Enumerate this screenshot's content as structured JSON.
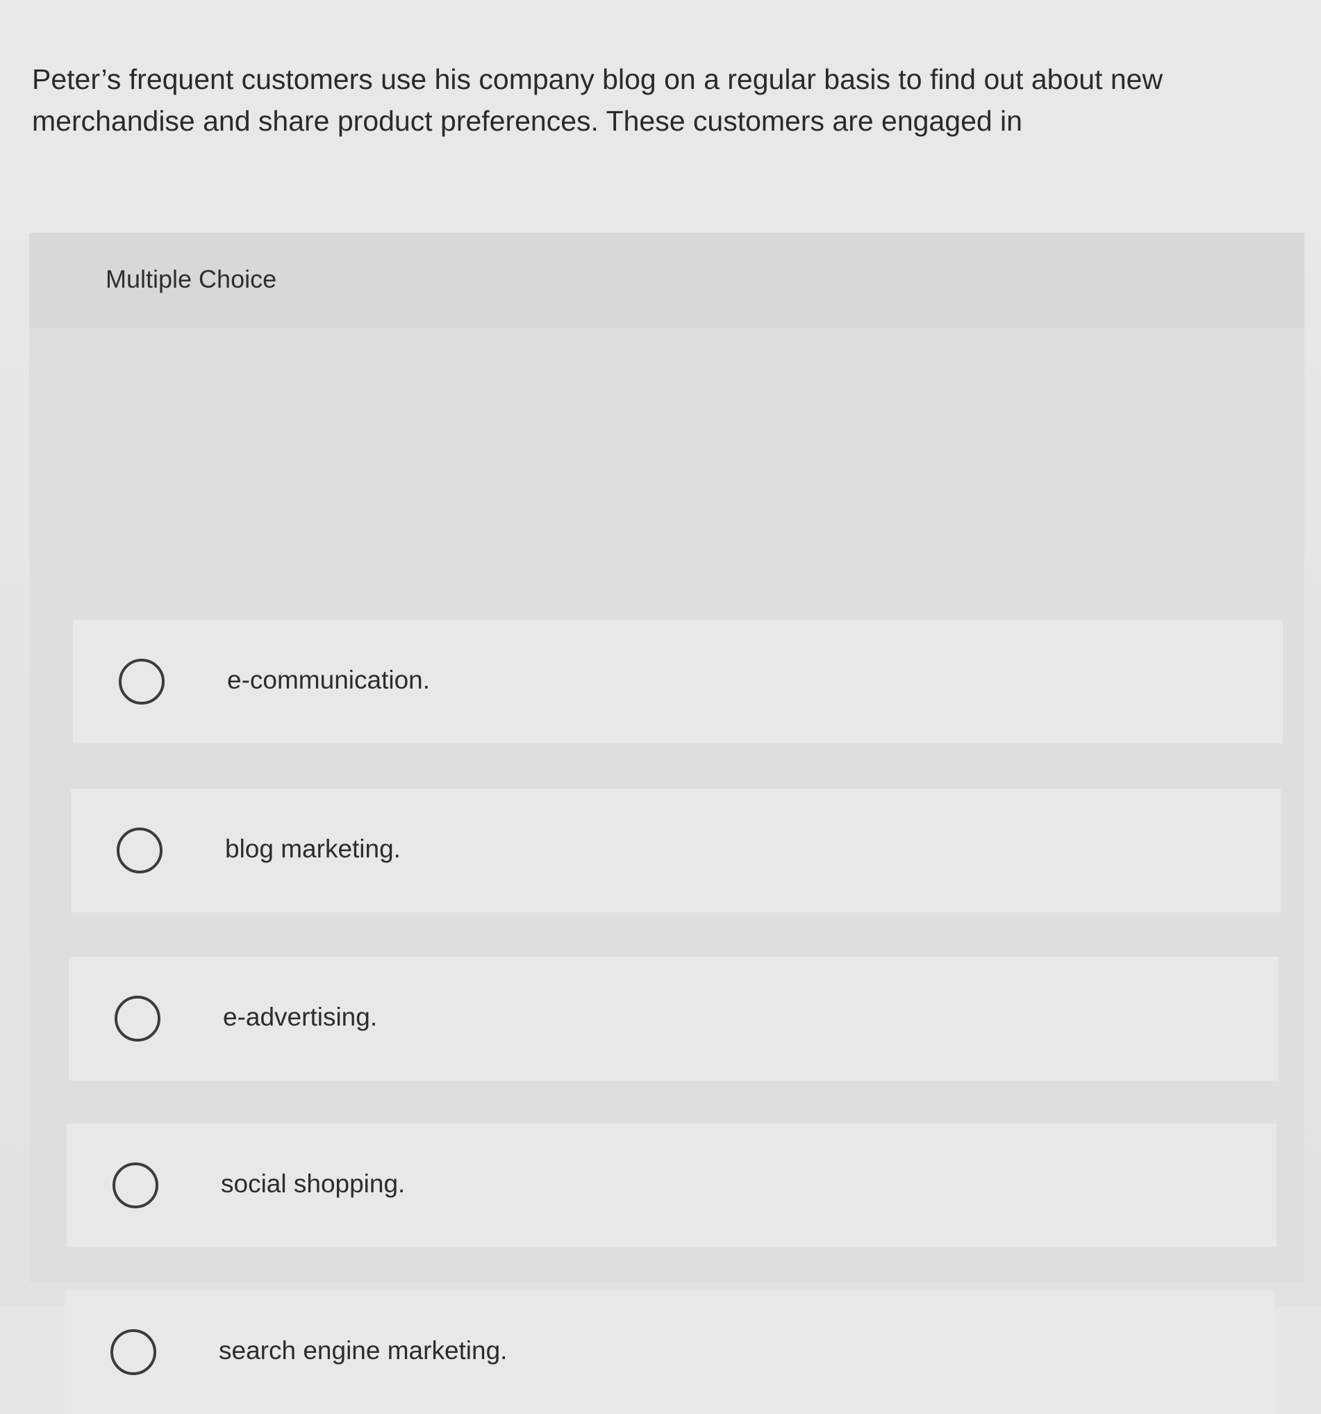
{
  "question": {
    "text": "Peter’s frequent customers use his company blog on a regular basis to find out about new merchandise and share product preferences. These customers are engaged in"
  },
  "multiple_choice": {
    "title": "Multiple Choice",
    "options": [
      {
        "label": "e-communication.",
        "selected": false
      },
      {
        "label": "blog marketing.",
        "selected": false
      },
      {
        "label": "e-advertising.",
        "selected": false
      },
      {
        "label": "social shopping.",
        "selected": false
      },
      {
        "label": "search engine marketing.",
        "selected": false
      }
    ]
  }
}
